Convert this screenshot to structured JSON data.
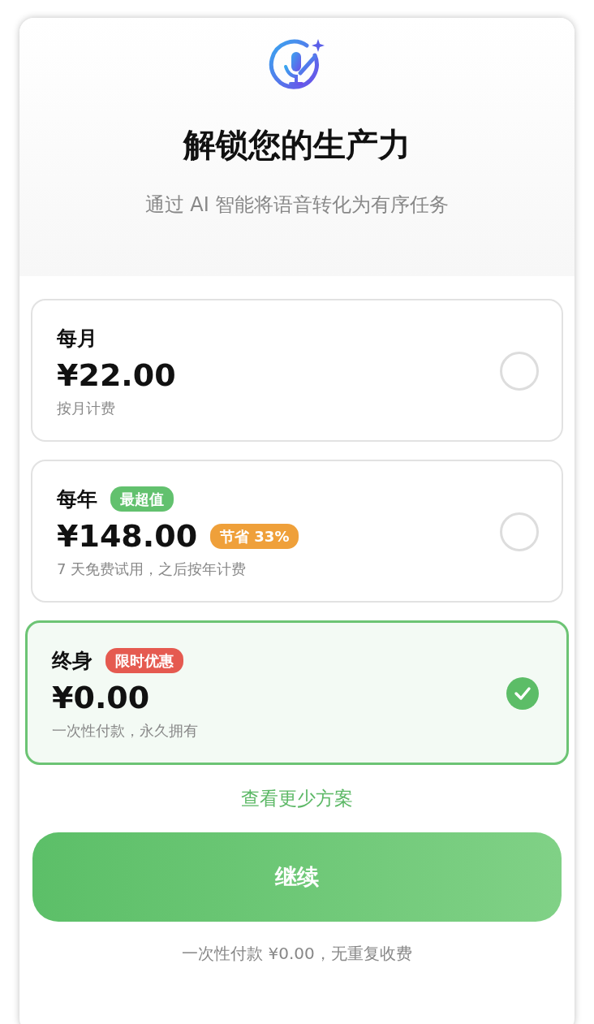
{
  "header": {
    "title": "解锁您的生产力",
    "subtitle": "通过 AI 智能将语音转化为有序任务"
  },
  "plans": [
    {
      "name": "每月",
      "price": "¥22.00",
      "note": "按月计费",
      "selected": false
    },
    {
      "name": "每年",
      "title_badge": {
        "text": "最超值",
        "color": "#62c16e"
      },
      "price": "¥148.00",
      "price_badge": {
        "text": "节省 33%",
        "color": "#efa03a"
      },
      "note": "7 天免费试用，之后按年计费",
      "selected": false
    },
    {
      "name": "终身",
      "title_badge": {
        "text": "限时优惠",
        "color": "#e55a50"
      },
      "price": "¥0.00",
      "note": "一次性付款，永久拥有",
      "selected": true
    }
  ],
  "toggle_link": "查看更少方案",
  "continue_button": "继续",
  "footnote": "一次性付款 ¥0.00，无重复收费"
}
